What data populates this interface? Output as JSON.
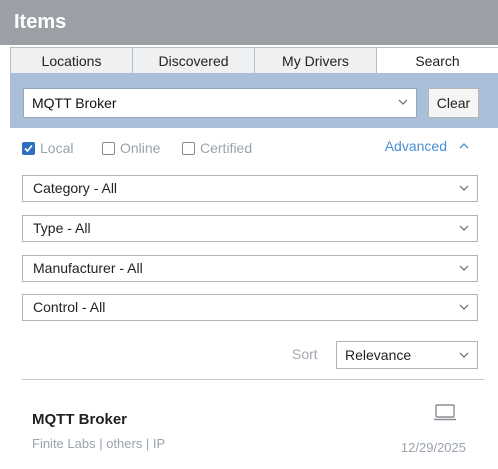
{
  "panel": {
    "title": "Items"
  },
  "tabs": [
    {
      "label": "Locations"
    },
    {
      "label": "Discovered"
    },
    {
      "label": "My Drivers"
    },
    {
      "label": "Search"
    }
  ],
  "search": {
    "value": "MQTT Broker",
    "clear_label": "Clear"
  },
  "filters": {
    "local": {
      "label": "Local",
      "checked": true
    },
    "online": {
      "label": "Online",
      "checked": false
    },
    "certified": {
      "label": "Certified",
      "checked": false
    },
    "advanced_label": "Advanced"
  },
  "dropdowns": [
    {
      "label": "Category - All"
    },
    {
      "label": "Type - All"
    },
    {
      "label": "Manufacturer - All"
    },
    {
      "label": "Control - All"
    }
  ],
  "sort": {
    "label": "Sort",
    "value": "Relevance"
  },
  "results": [
    {
      "title": "MQTT Broker",
      "meta": "Finite Labs  |  others  |  IP",
      "date": "12/29/2025",
      "icon": "monitor-icon"
    }
  ],
  "colors": {
    "title_bar": "#9aa0a6",
    "search_band": "#aac0d8",
    "accent": "#4a8fd6",
    "checkbox_checked": "#2f6fc0"
  }
}
